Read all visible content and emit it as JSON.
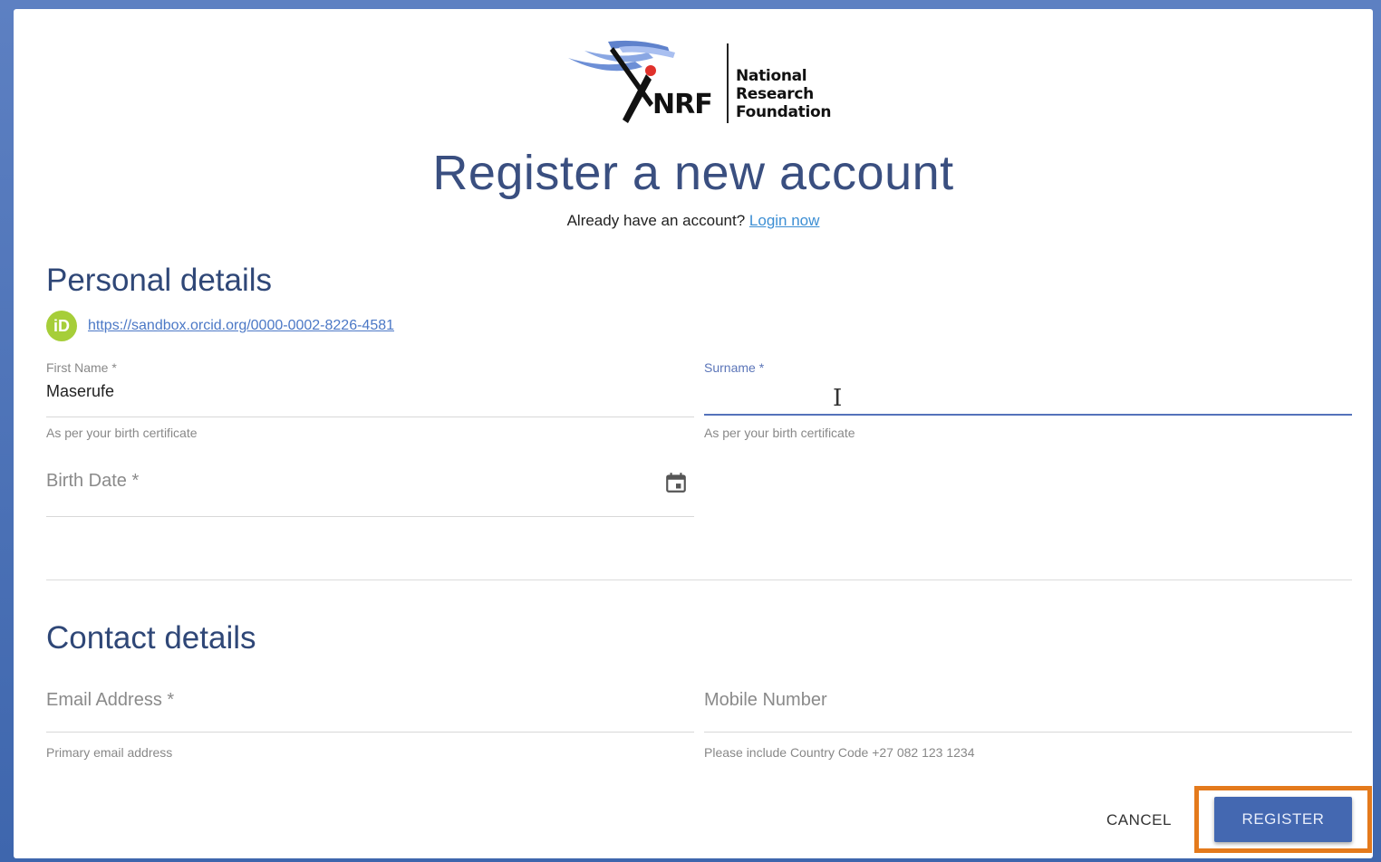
{
  "header": {
    "logo_short": "NRF",
    "logo_lines": [
      "National",
      "Research",
      "Foundation"
    ],
    "title": "Register a new account",
    "subtitle_text": "Already have an account?",
    "login_link": "Login now"
  },
  "personal": {
    "section_title": "Personal details",
    "orcid_badge": "iD",
    "orcid_url": "https://sandbox.orcid.org/0000-0002-8226-4581",
    "first_name": {
      "label": "First Name *",
      "value": "Maserufe",
      "hint": "As per your birth certificate"
    },
    "surname": {
      "label": "Surname *",
      "value": "",
      "hint": "As per your birth certificate"
    },
    "birth_date": {
      "placeholder": "Birth Date *"
    }
  },
  "contact": {
    "section_title": "Contact details",
    "email": {
      "placeholder": "Email Address *",
      "hint": "Primary email address"
    },
    "mobile": {
      "placeholder": "Mobile Number",
      "hint": "Please include Country Code +27 082 123 1234"
    }
  },
  "actions": {
    "cancel_label": "CANCEL",
    "register_label": "REGISTER"
  },
  "colors": {
    "title": "#3a4f80",
    "accent": "#4468b1",
    "highlight": "#e47a1c",
    "orcid": "#a6ce39",
    "link": "#3d8fd4"
  },
  "icons": [
    "nrf-logo",
    "orcid-icon",
    "calendar-icon",
    "text-cursor-icon"
  ]
}
